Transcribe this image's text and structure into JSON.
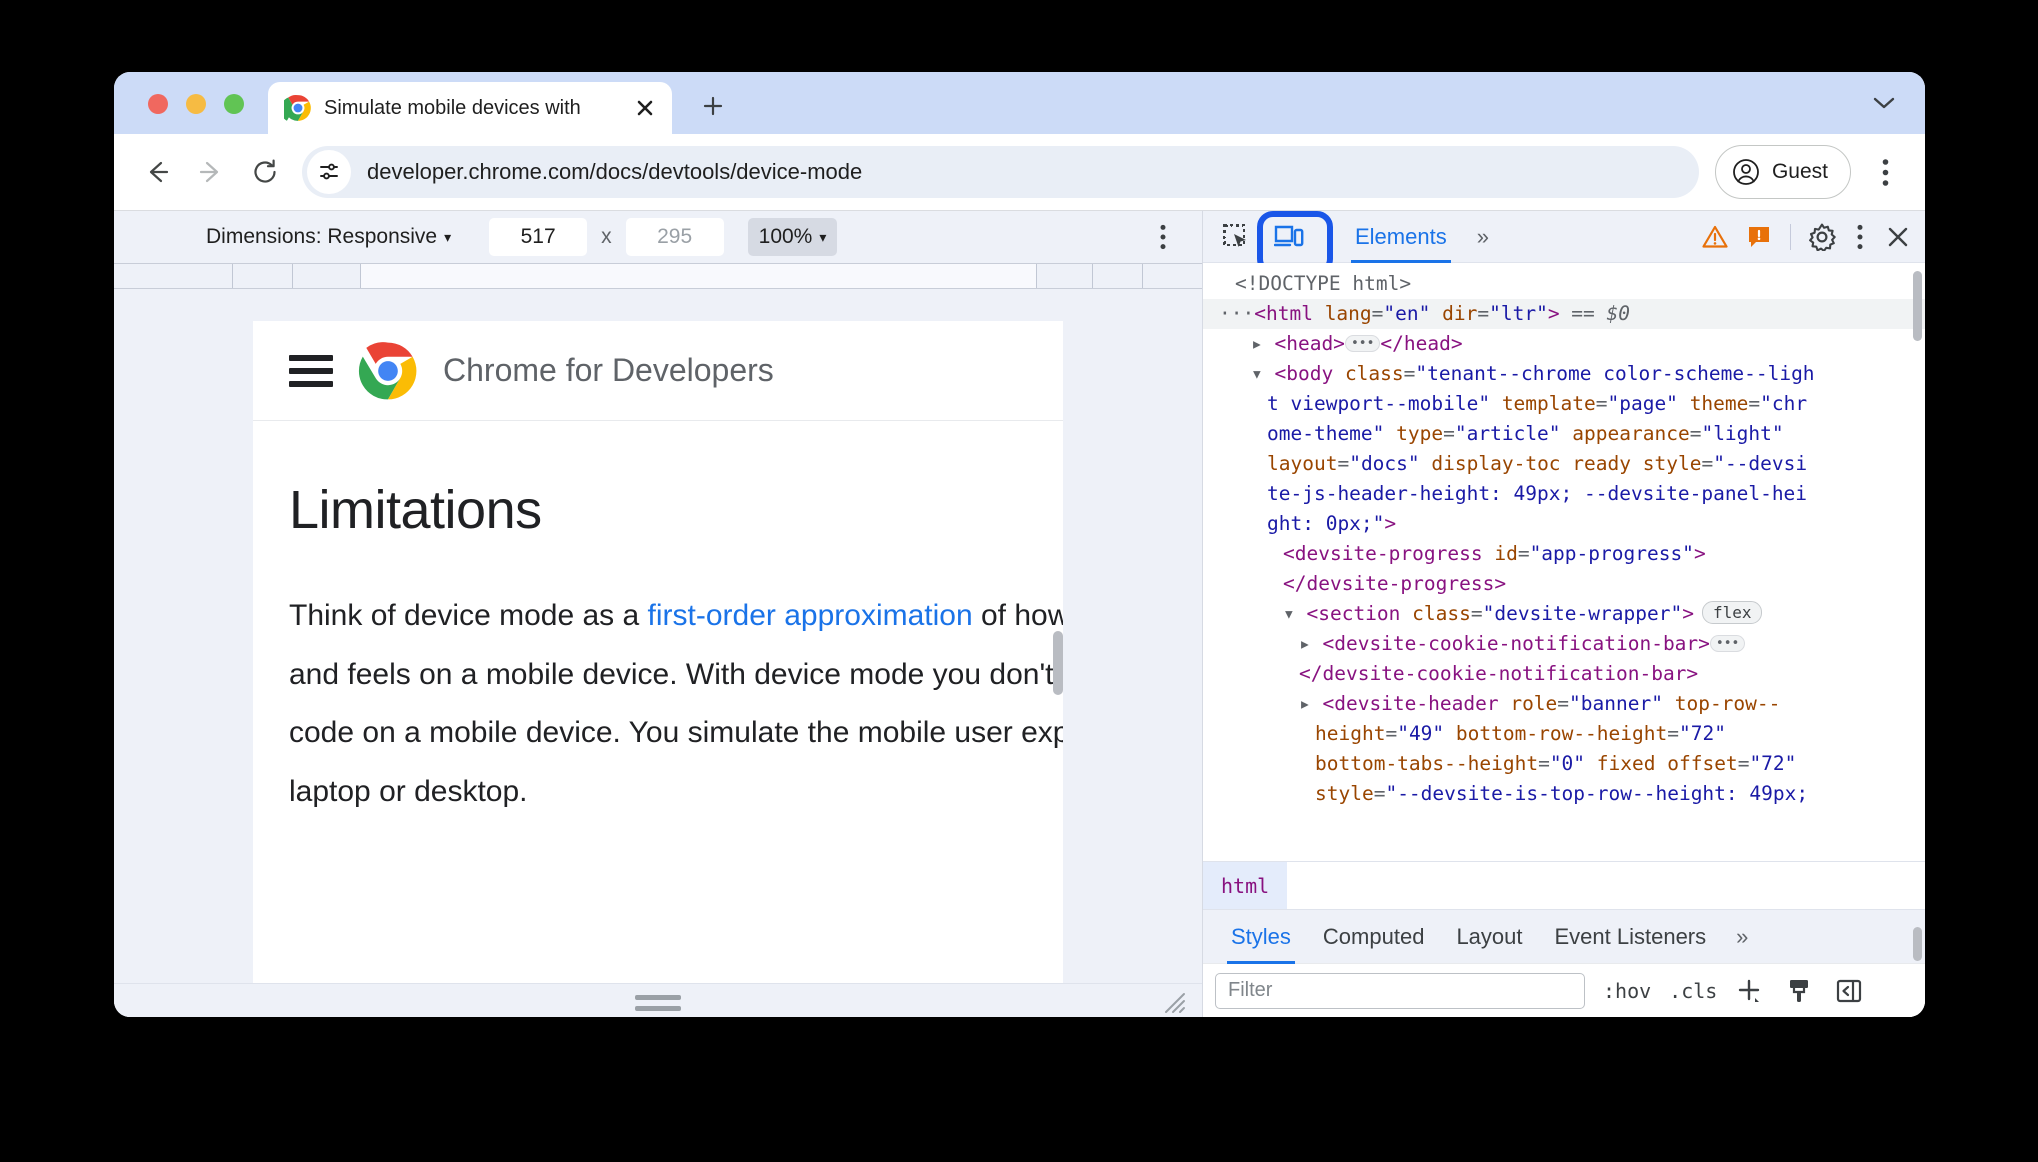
{
  "browser": {
    "tab": {
      "title": "Simulate mobile devices with",
      "favicon_icon": "chrome-logo-icon",
      "close_icon": "close-icon"
    },
    "new_tab_icon": "plus-icon",
    "tabstrip_menu_icon": "chevron-down-icon",
    "nav": {
      "back_icon": "arrow-left-icon",
      "forward_icon": "arrow-right-icon",
      "reload_icon": "reload-icon"
    },
    "omnibox": {
      "site_info_icon": "tune-settings-icon",
      "url": "developer.chrome.com/docs/devtools/device-mode"
    },
    "profile": {
      "label": "Guest",
      "icon": "account-circle-icon"
    },
    "menu_icon": "three-dots-vertical-icon"
  },
  "device_toolbar": {
    "dimensions_label": "Dimensions: Responsive",
    "dimensions_caret": "▾",
    "width_value": "517",
    "multiply": "x",
    "height_placeholder": "295",
    "zoom_label": "100%",
    "zoom_caret": "▾",
    "more_icon": "three-dots-vertical-icon"
  },
  "page": {
    "menu_icon": "hamburger-icon",
    "logo_icon": "chrome-logo-icon",
    "site_title": "Chrome for Developers",
    "heading": "Limitations",
    "paragraph_before": "Think of device mode as a ",
    "paragraph_link": "first-order approximation",
    "paragraph_after": " of how your page looks and feels on a mobile device. With device mode you don't actually run your code on a mobile device. You simulate the mobile user experience from your laptop or desktop."
  },
  "devtools": {
    "inspect_icon": "inspect-element-icon",
    "device_toggle_icon": "device-toolbar-icon",
    "tabs": [
      {
        "label": "Elements",
        "active": true
      }
    ],
    "more_tabs_icon": "chevrons-right-icon",
    "more_tabs_label": "»",
    "warning_icon": "warning-triangle-icon",
    "issues_icon": "issues-icon",
    "settings_icon": "gear-icon",
    "menu_icon": "three-dots-vertical-icon",
    "close_icon": "close-icon",
    "accent_blue": "#1a73e8",
    "highlight_ring": "#1a56e8",
    "warning_color": "#e8710a",
    "dom_tree": [
      {
        "indent": 1,
        "marker": "",
        "parts": [
          {
            "t": "gray",
            "s": "<!DOCTYPE html>"
          }
        ]
      },
      {
        "indent": 0,
        "marker": "ellipsis-dots",
        "selected": true,
        "parts": [
          {
            "t": "gray",
            "s": "···"
          },
          {
            "t": "tag",
            "s": "<html "
          },
          {
            "t": "attr",
            "s": "lang"
          },
          {
            "t": "punc2",
            "s": "="
          },
          {
            "t": "val",
            "s": "\"en\""
          },
          {
            "t": "plain",
            "s": " "
          },
          {
            "t": "attr",
            "s": "dir"
          },
          {
            "t": "punc2",
            "s": "="
          },
          {
            "t": "val",
            "s": "\"ltr\""
          },
          {
            "t": "tag",
            "s": ">"
          },
          {
            "t": "eq0",
            "s": " == $0"
          }
        ]
      },
      {
        "indent": 2,
        "marker": "▸",
        "parts": [
          {
            "t": "tag",
            "s": "<head>"
          },
          {
            "t": "btn",
            "s": "…"
          },
          {
            "t": "tag",
            "s": "</head>"
          }
        ]
      },
      {
        "indent": 2,
        "marker": "▾",
        "parts": [
          {
            "t": "tag",
            "s": "<body "
          },
          {
            "t": "attr",
            "s": "class"
          },
          {
            "t": "punc2",
            "s": "="
          },
          {
            "t": "val",
            "s": "\"tenant--chrome color-scheme--ligh"
          }
        ]
      },
      {
        "indent": 3,
        "marker": "",
        "parts": [
          {
            "t": "val",
            "s": "t viewport--mobile\""
          },
          {
            "t": "plain",
            "s": " "
          },
          {
            "t": "attr",
            "s": "template"
          },
          {
            "t": "punc2",
            "s": "="
          },
          {
            "t": "val",
            "s": "\"page\""
          },
          {
            "t": "plain",
            "s": " "
          },
          {
            "t": "attr",
            "s": "theme"
          },
          {
            "t": "punc2",
            "s": "="
          },
          {
            "t": "val",
            "s": "\"chr"
          }
        ]
      },
      {
        "indent": 3,
        "marker": "",
        "parts": [
          {
            "t": "val",
            "s": "ome-theme\""
          },
          {
            "t": "plain",
            "s": " "
          },
          {
            "t": "attr",
            "s": "type"
          },
          {
            "t": "punc2",
            "s": "="
          },
          {
            "t": "val",
            "s": "\"article\""
          },
          {
            "t": "plain",
            "s": " "
          },
          {
            "t": "attr",
            "s": "appearance"
          },
          {
            "t": "punc2",
            "s": "="
          },
          {
            "t": "val",
            "s": "\"light\""
          }
        ]
      },
      {
        "indent": 3,
        "marker": "",
        "parts": [
          {
            "t": "attr",
            "s": "layout"
          },
          {
            "t": "punc2",
            "s": "="
          },
          {
            "t": "val",
            "s": "\"docs\""
          },
          {
            "t": "plain",
            "s": " "
          },
          {
            "t": "attr",
            "s": "display-toc ready"
          },
          {
            "t": "plain",
            "s": " "
          },
          {
            "t": "attr",
            "s": "style"
          },
          {
            "t": "punc2",
            "s": "="
          },
          {
            "t": "val",
            "s": "\"--devsi"
          }
        ]
      },
      {
        "indent": 3,
        "marker": "",
        "parts": [
          {
            "t": "val",
            "s": "te-js-header-height: 49px; --devsite-panel-hei"
          }
        ]
      },
      {
        "indent": 3,
        "marker": "",
        "parts": [
          {
            "t": "val",
            "s": "ght: 0px;\""
          },
          {
            "t": "tag",
            "s": ">"
          }
        ]
      },
      {
        "indent": 4,
        "marker": "",
        "parts": [
          {
            "t": "tag",
            "s": "<devsite-progress "
          },
          {
            "t": "attr",
            "s": "id"
          },
          {
            "t": "punc2",
            "s": "="
          },
          {
            "t": "val",
            "s": "\"app-progress\""
          },
          {
            "t": "tag",
            "s": ">"
          }
        ]
      },
      {
        "indent": 4,
        "marker": "",
        "parts": [
          {
            "t": "tag",
            "s": "</devsite-progress>"
          }
        ]
      },
      {
        "indent": 4,
        "marker": "▾",
        "parts": [
          {
            "t": "tag",
            "s": "<section "
          },
          {
            "t": "attr",
            "s": "class"
          },
          {
            "t": "punc2",
            "s": "="
          },
          {
            "t": "val",
            "s": "\"devsite-wrapper\""
          },
          {
            "t": "tag",
            "s": ">"
          },
          {
            "t": "flex",
            "s": "flex"
          }
        ]
      },
      {
        "indent": 5,
        "marker": "▸",
        "parts": [
          {
            "t": "tag",
            "s": "<devsite-cookie-notification-bar>"
          },
          {
            "t": "btn",
            "s": "…"
          }
        ]
      },
      {
        "indent": 5,
        "marker": "",
        "parts": [
          {
            "t": "tag",
            "s": "</devsite-cookie-notification-bar>"
          }
        ]
      },
      {
        "indent": 5,
        "marker": "▸",
        "parts": [
          {
            "t": "tag",
            "s": "<devsite-header "
          },
          {
            "t": "attr",
            "s": "role"
          },
          {
            "t": "punc2",
            "s": "="
          },
          {
            "t": "val",
            "s": "\"banner\""
          },
          {
            "t": "plain",
            "s": " "
          },
          {
            "t": "attr",
            "s": "top-row--"
          }
        ]
      },
      {
        "indent": 6,
        "marker": "",
        "parts": [
          {
            "t": "attr",
            "s": "height"
          },
          {
            "t": "punc2",
            "s": "="
          },
          {
            "t": "val",
            "s": "\"49\""
          },
          {
            "t": "plain",
            "s": " "
          },
          {
            "t": "attr",
            "s": "bottom-row--height"
          },
          {
            "t": "punc2",
            "s": "="
          },
          {
            "t": "val",
            "s": "\"72\""
          }
        ]
      },
      {
        "indent": 6,
        "marker": "",
        "parts": [
          {
            "t": "attr",
            "s": "bottom-tabs--height"
          },
          {
            "t": "punc2",
            "s": "="
          },
          {
            "t": "val",
            "s": "\"0\""
          },
          {
            "t": "plain",
            "s": " "
          },
          {
            "t": "attr",
            "s": "fixed offset"
          },
          {
            "t": "punc2",
            "s": "="
          },
          {
            "t": "val",
            "s": "\"72\""
          }
        ]
      },
      {
        "indent": 6,
        "marker": "",
        "clipped": true,
        "parts": [
          {
            "t": "attr",
            "s": "style"
          },
          {
            "t": "punc2",
            "s": "="
          },
          {
            "t": "val",
            "s": "\"--devsite-is-top-row--height: 49px;"
          }
        ]
      }
    ],
    "breadcrumb": [
      "html"
    ],
    "sidebar_tabs": [
      {
        "label": "Styles",
        "active": true
      },
      {
        "label": "Computed",
        "active": false
      },
      {
        "label": "Layout",
        "active": false
      },
      {
        "label": "Event Listeners",
        "active": false
      }
    ],
    "sidebar_more_label": "»",
    "styles_toolbar": {
      "filter_placeholder": "Filter",
      "hov_label": ":hov",
      "cls_label": ".cls",
      "new_rule_icon": "plus-icon",
      "copy_styles_icon": "paintbrush-icon",
      "toggle_sidebar_icon": "panel-toggle-icon"
    }
  }
}
